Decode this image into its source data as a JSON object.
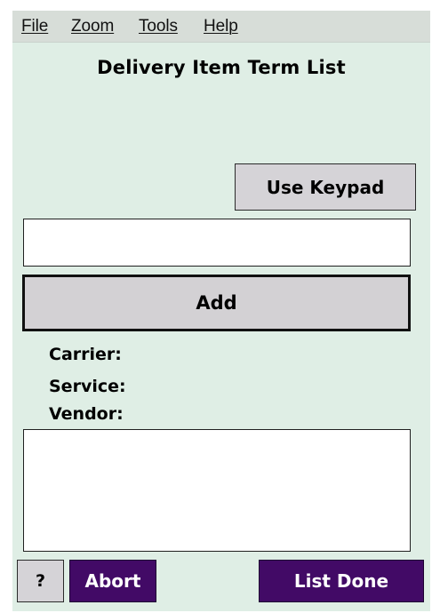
{
  "menu": {
    "file": "File",
    "zoom": "Zoom",
    "tools": "Tools",
    "help": "Help"
  },
  "title": "Delivery Item Term List",
  "buttons": {
    "use_keypad": "Use Keypad",
    "add": "Add",
    "help": "?",
    "abort": "Abort",
    "list_done": "List Done"
  },
  "input": {
    "value": "",
    "placeholder": ""
  },
  "fields": {
    "carrier_label": "Carrier:",
    "service_label": "Service:",
    "vendor_label": "Vendor:"
  },
  "list": {
    "items": []
  },
  "colors": {
    "background": "#dfeee5",
    "menubar": "#d7ddd8",
    "gray_button": "#d5d3d7",
    "purple_button": "#420a66"
  }
}
